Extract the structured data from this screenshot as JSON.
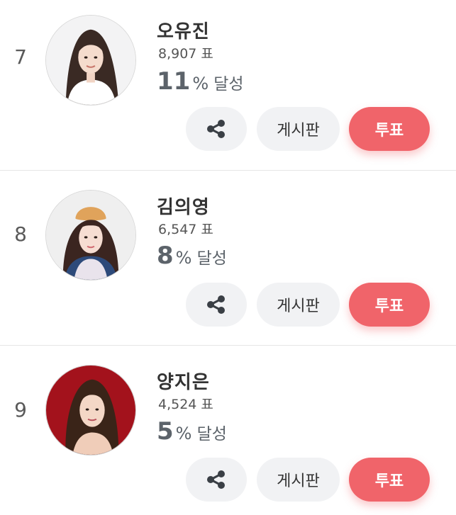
{
  "accent_color": "#f0646a",
  "candidates": [
    {
      "rank": "7",
      "name": "오유진",
      "votes": "8,907 표",
      "percent": "11",
      "percent_symbol": "%",
      "percent_label": "달성",
      "share_icon": "share-icon",
      "board_label": "게시판",
      "vote_label": "투표"
    },
    {
      "rank": "8",
      "name": "김의영",
      "votes": "6,547 표",
      "percent": "8",
      "percent_symbol": "%",
      "percent_label": "달성",
      "share_icon": "share-icon",
      "board_label": "게시판",
      "vote_label": "투표"
    },
    {
      "rank": "9",
      "name": "양지은",
      "votes": "4,524 표",
      "percent": "5",
      "percent_symbol": "%",
      "percent_label": "달성",
      "share_icon": "share-icon",
      "board_label": "게시판",
      "vote_label": "투표"
    }
  ]
}
